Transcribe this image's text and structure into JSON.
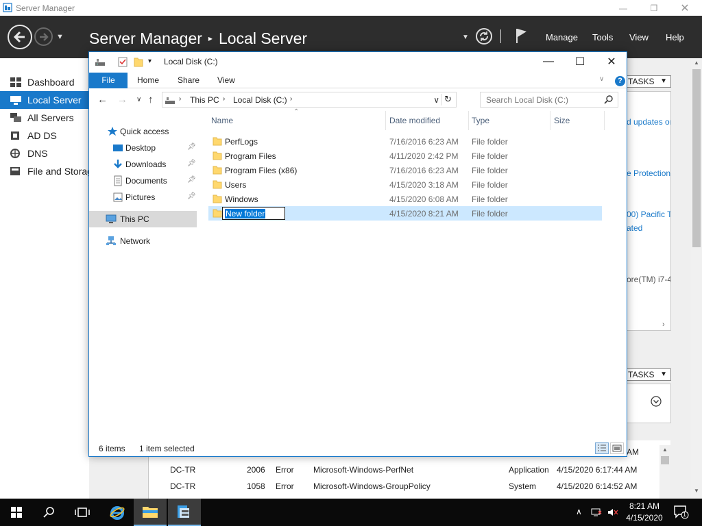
{
  "server_manager": {
    "window_title": "Server Manager",
    "breadcrumb_root": "Server Manager",
    "breadcrumb_current": "Local Server",
    "menu": [
      "Manage",
      "Tools",
      "View",
      "Help"
    ],
    "nav_items": [
      {
        "label": "Dashboard",
        "icon": "dashboard-icon"
      },
      {
        "label": "Local Server",
        "icon": "server-icon"
      },
      {
        "label": "All Servers",
        "icon": "servers-icon"
      },
      {
        "label": "AD DS",
        "icon": "ad-ds-icon"
      },
      {
        "label": "DNS",
        "icon": "dns-icon"
      },
      {
        "label": "File and Storage Services",
        "icon": "storage-icon"
      }
    ],
    "tasks_label": "TASKS",
    "background_fragments": [
      "d updates or",
      "e Protection:",
      "00) Pacific Ti",
      "ated",
      "ore(TM) i7-4"
    ],
    "partial_event_time": "AM",
    "events": [
      {
        "server": "DC-TR",
        "id": "2006",
        "severity": "Error",
        "source": "Microsoft-Windows-PerfNet",
        "log": "Application",
        "date": "4/15/2020 6:17:44 AM"
      },
      {
        "server": "DC-TR",
        "id": "1058",
        "severity": "Error",
        "source": "Microsoft-Windows-GroupPolicy",
        "log": "System",
        "date": "4/15/2020 6:14:52 AM"
      }
    ],
    "accent_color": "#1979ca"
  },
  "explorer": {
    "title": "Local Disk (C:)",
    "ribbon_tabs": [
      "File",
      "Home",
      "Share",
      "View"
    ],
    "address": [
      "This PC",
      "Local Disk (C:)"
    ],
    "search_placeholder": "Search Local Disk (C:)",
    "nav_pane": [
      {
        "label": "Quick access",
        "icon": "star-icon",
        "pinned": false
      },
      {
        "label": "Desktop",
        "icon": "desktop-icon",
        "pinned": true
      },
      {
        "label": "Downloads",
        "icon": "downloads-icon",
        "pinned": true
      },
      {
        "label": "Documents",
        "icon": "documents-icon",
        "pinned": true
      },
      {
        "label": "Pictures",
        "icon": "pictures-icon",
        "pinned": true
      },
      {
        "label": "This PC",
        "icon": "computer-icon",
        "pinned": false
      },
      {
        "label": "Network",
        "icon": "network-icon",
        "pinned": false
      }
    ],
    "columns": [
      "Name",
      "Date modified",
      "Type",
      "Size"
    ],
    "files": [
      {
        "name": "PerfLogs",
        "date": "7/16/2016 6:23 AM",
        "type": "File folder"
      },
      {
        "name": "Program Files",
        "date": "4/11/2020 2:42 PM",
        "type": "File folder"
      },
      {
        "name": "Program Files (x86)",
        "date": "7/16/2016 6:23 AM",
        "type": "File folder"
      },
      {
        "name": "Users",
        "date": "4/15/2020 3:18 AM",
        "type": "File folder"
      },
      {
        "name": "Windows",
        "date": "4/15/2020 6:08 AM",
        "type": "File folder"
      },
      {
        "name": "New folder",
        "date": "4/15/2020 8:21 AM",
        "type": "File folder"
      }
    ],
    "status_items": "6 items",
    "status_selected": "1 item selected"
  },
  "taskbar": {
    "time": "8:21 AM",
    "date": "4/15/2020",
    "notification_count": "1"
  }
}
